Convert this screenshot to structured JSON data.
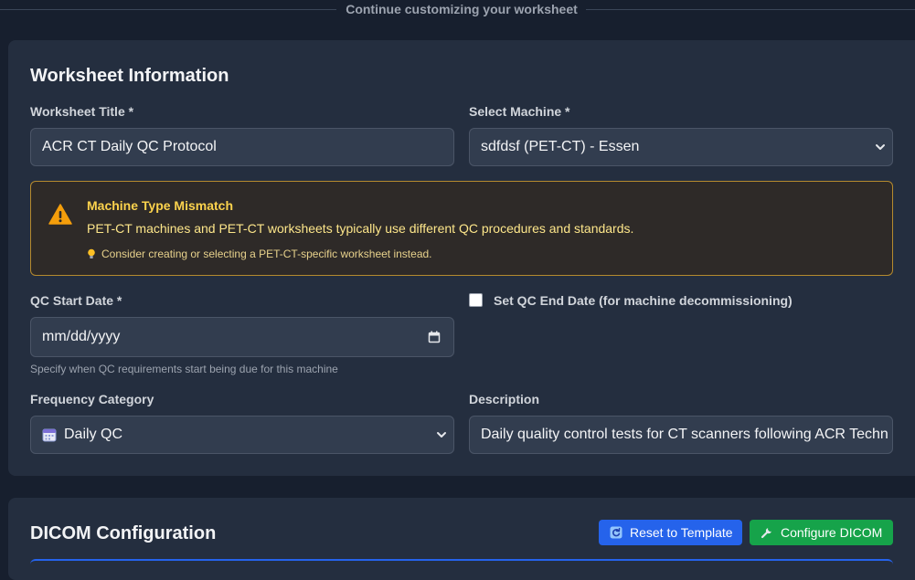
{
  "header": {
    "subtitle": "Continue customizing your worksheet"
  },
  "worksheet_info": {
    "title": "Worksheet Information",
    "worksheet_title_label": "Worksheet Title *",
    "worksheet_title_value": "ACR CT Daily QC Protocol",
    "select_machine_label": "Select Machine *",
    "select_machine_value": "sdfdsf (PET-CT) - Essen",
    "alert": {
      "title": "Machine Type Mismatch",
      "message": "PET-CT machines and PET-CT worksheets typically use different QC procedures and standards.",
      "tip": "Consider creating or selecting a PET-CT-specific worksheet instead.",
      "icon": "warning-icon",
      "tip_icon": "lightbulb-icon"
    },
    "qc_start_label": "QC Start Date *",
    "qc_start_placeholder": "mm/dd/yyyy",
    "qc_start_help": "Specify when QC requirements start being due for this machine",
    "end_date_checkbox_label": "Set QC End Date (for machine decommissioning)",
    "end_date_checked": false,
    "frequency_label": "Frequency Category",
    "frequency_value": "Daily QC",
    "frequency_icon": "calendar-icon",
    "description_label": "Description",
    "description_value": "Daily quality control tests for CT scanners following ACR Techn"
  },
  "dicom": {
    "title": "DICOM Configuration",
    "reset_button": "Reset to Template",
    "configure_button": "Configure DICOM"
  },
  "colors": {
    "background": "#171f2e",
    "card": "#242e3f",
    "input": "#323d4f",
    "warning_border": "#b58a2e",
    "warning_text": "#fcd34d",
    "primary_button": "#2563eb",
    "success_button": "#16a34a"
  }
}
